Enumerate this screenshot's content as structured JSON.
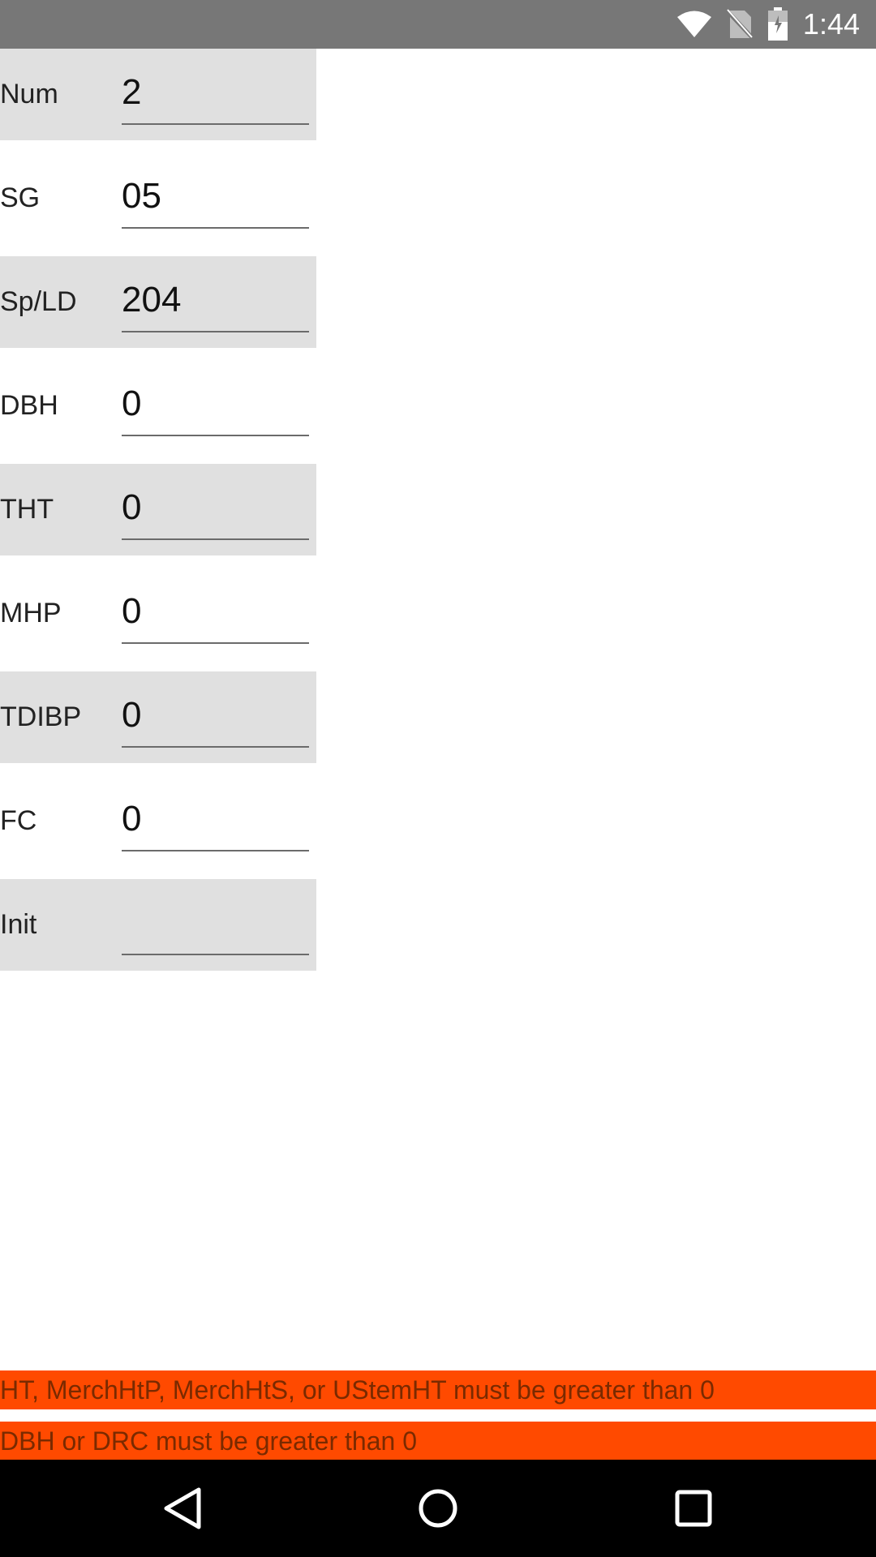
{
  "status_bar": {
    "time": "1:44",
    "icons": [
      "wifi-icon",
      "no-sim-icon",
      "battery-icon"
    ]
  },
  "form": {
    "rows": [
      {
        "label": "Num",
        "value": "2"
      },
      {
        "label": "SG",
        "value": "05"
      },
      {
        "label": "Sp/LD",
        "value": "204"
      },
      {
        "label": "DBH",
        "value": "0"
      },
      {
        "label": "THT",
        "value": "0"
      },
      {
        "label": "MHP",
        "value": "0"
      },
      {
        "label": "TDIBP",
        "value": "0"
      },
      {
        "label": "FC",
        "value": "0"
      },
      {
        "label": "Init",
        "value": ""
      }
    ]
  },
  "errors": [
    "HT, MerchHtP, MerchHtS, or UStemHT must be greater than 0",
    "DBH or DRC must be greater than 0"
  ],
  "nav_bar": {
    "icons": [
      "back-icon",
      "home-icon",
      "recents-icon"
    ]
  },
  "colors": {
    "status_bar": "#777777",
    "row_shade": "#e0e0e0",
    "error_background": "#ff4a00",
    "nav_bar": "#000000"
  }
}
